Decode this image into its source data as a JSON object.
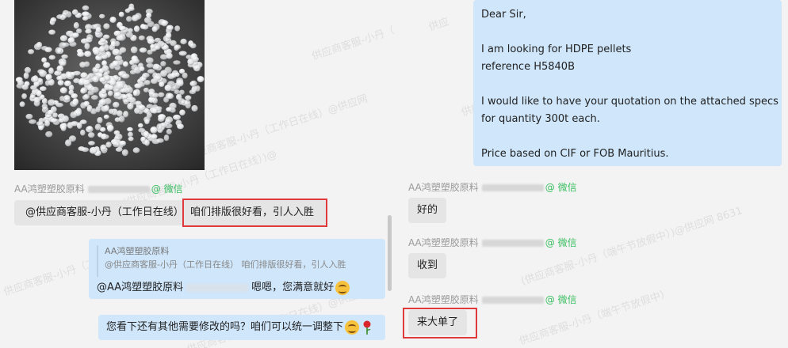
{
  "left_panel": {
    "watermarks": [
      "供应商客服-小丹（工作",
      "供应商客服-小丹（工作日在线）@供应网",
      "(供应商客服-小丹（工作日在线）)@",
      "供应商客服-小丹（工作日在线）",
      "供应商客服-小丹（工作日在线）@供应网",
      "供应网 8631"
    ],
    "messages": [
      {
        "sender": "AA鸿塑塑胶原料",
        "platform": "@ 微信",
        "mention": "@供应商客服-小丹（工作日在线）",
        "highlighted_text": "咱们排版很好看，引人入胜"
      }
    ],
    "reply_card": {
      "quoted_sender": "AA鸿塑塑胶原料",
      "quoted_text": "@供应商客服-小丹（工作日在线） 咱们排版很好看，引人入胜",
      "reply_mention": "@AA鸿塑塑胶原料",
      "reply_text": "嗯嗯，您满意就好"
    },
    "last_bubble": "您看下还有其他需要修改的吗？咱们可以统一调整下"
  },
  "right_panel": {
    "email_lines": [
      "Dear Sir,",
      "",
      "I am looking for HDPE pellets",
      "reference H5840B",
      "",
      "I would like to have your quotation on the attached specs",
      "for quantity 300t each.",
      "",
      "Price based on CIF or FOB Mauritius."
    ],
    "messages": [
      {
        "sender": "AA鸿塑塑胶原料",
        "platform": "@ 微信",
        "text": "好的"
      },
      {
        "sender": "AA鸿塑塑胶原料",
        "platform": "@ 微信",
        "text": "收到"
      },
      {
        "sender": "AA鸿塑塑胶原料",
        "platform": "@ 微信",
        "text": "来大单了"
      }
    ],
    "watermarks": [
      "(供应商客服-小丹（端午节放假中）)@供应网 8631",
      "供应商客服-小丹（端午节放假中）",
      "供应",
      "供应网 8631"
    ]
  },
  "colors": {
    "highlight_border": "#e0393b",
    "self_bubble": "#cfe6fb",
    "other_bubble": "#e5e5e5",
    "wechat_tag": "#3bbf62"
  }
}
